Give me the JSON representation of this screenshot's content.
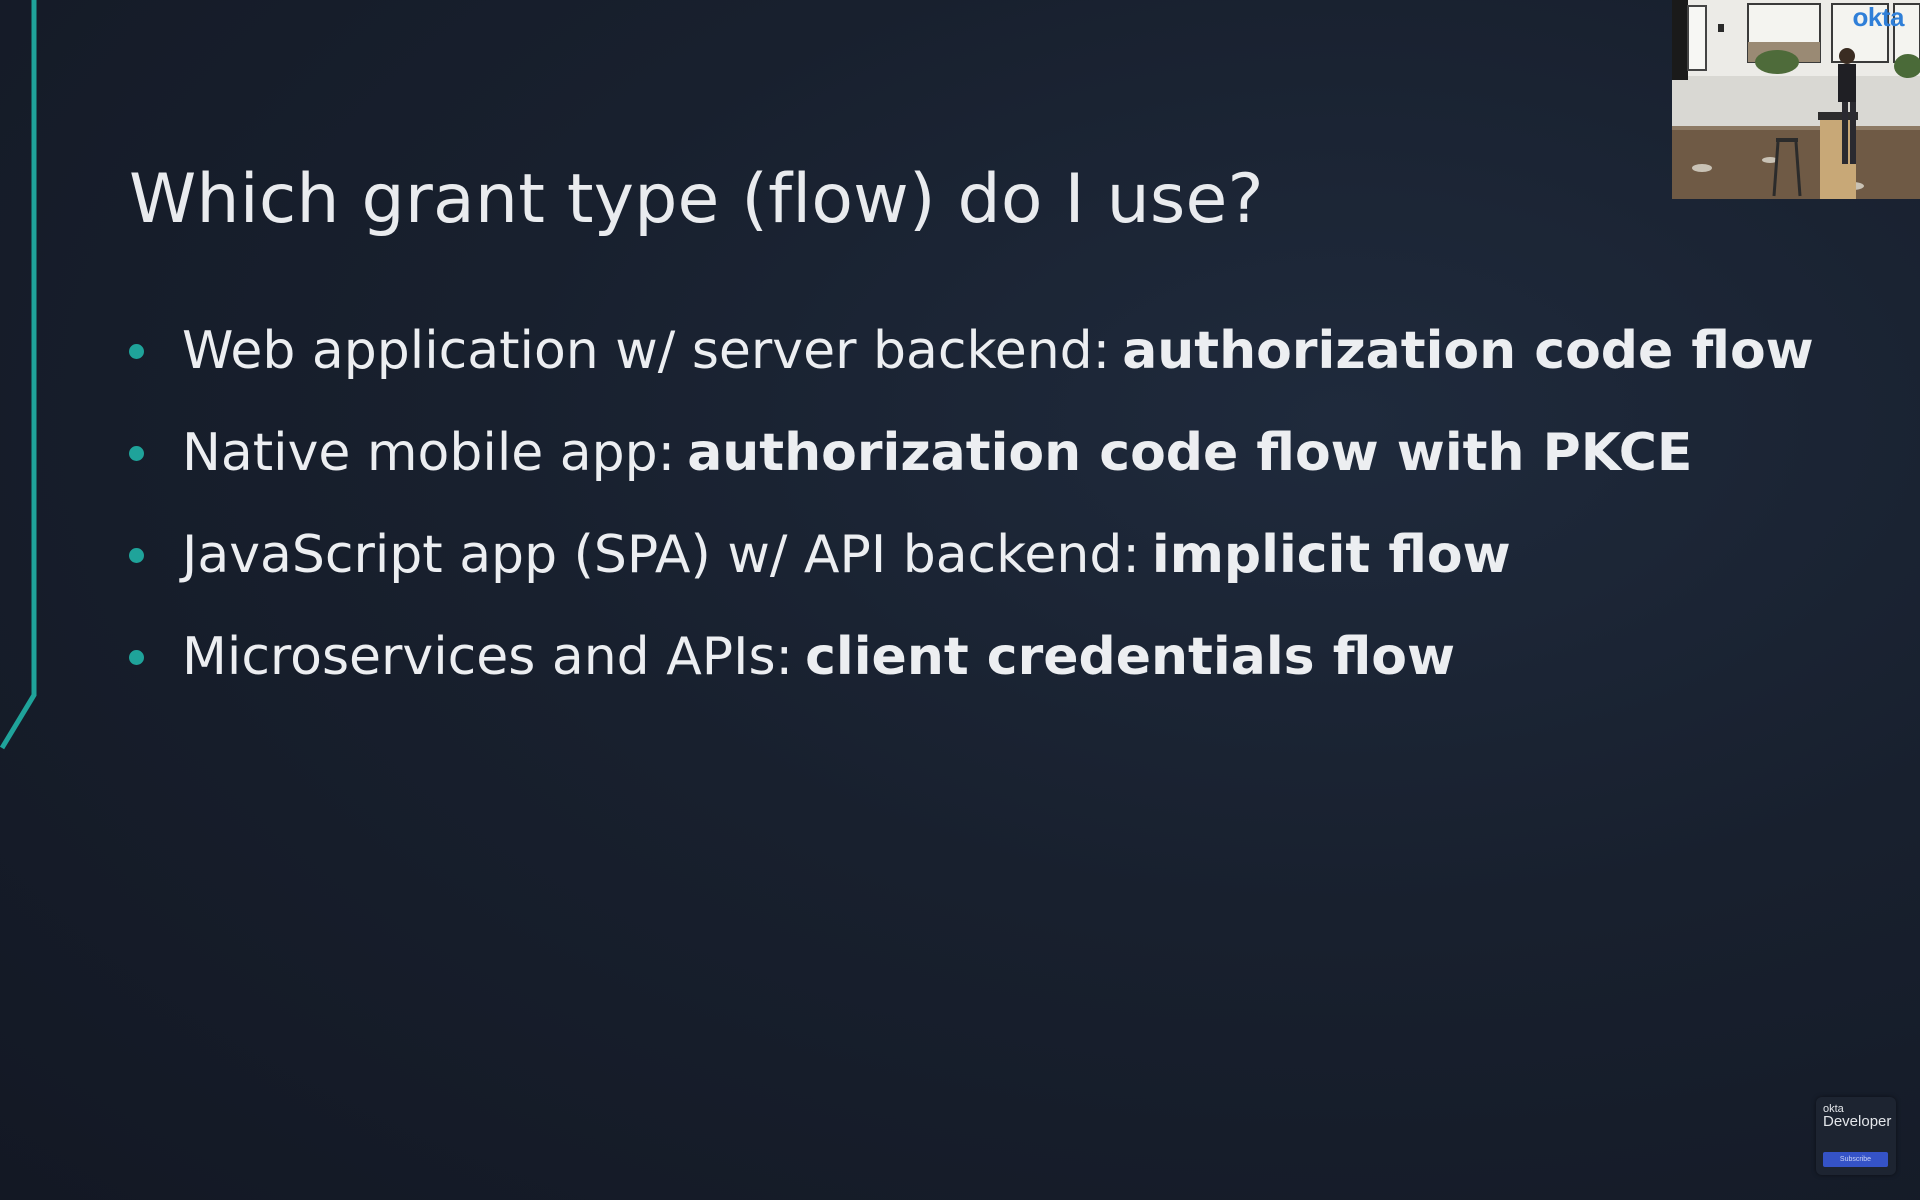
{
  "slide": {
    "title": "Which grant type (flow) do I use?",
    "bullets": [
      {
        "text": "Web application w/ server backend:",
        "emphasis": "authorization code flow"
      },
      {
        "text": "Native mobile app:",
        "emphasis": "authorization code flow with PKCE"
      },
      {
        "text": "JavaScript app (SPA) w/ API backend:",
        "emphasis": "implicit flow"
      },
      {
        "text": "Microservices and APIs:",
        "emphasis": "client credentials flow"
      }
    ]
  },
  "presenter_cam": {
    "logo": "okta"
  },
  "watermark": {
    "brand": "okta",
    "product": "Developer",
    "subscribe_label": "Subscribe"
  },
  "colors": {
    "background": "#18202e",
    "accent": "#1fa39a",
    "text": "#eceef1",
    "subscribe": "#3553c7"
  }
}
